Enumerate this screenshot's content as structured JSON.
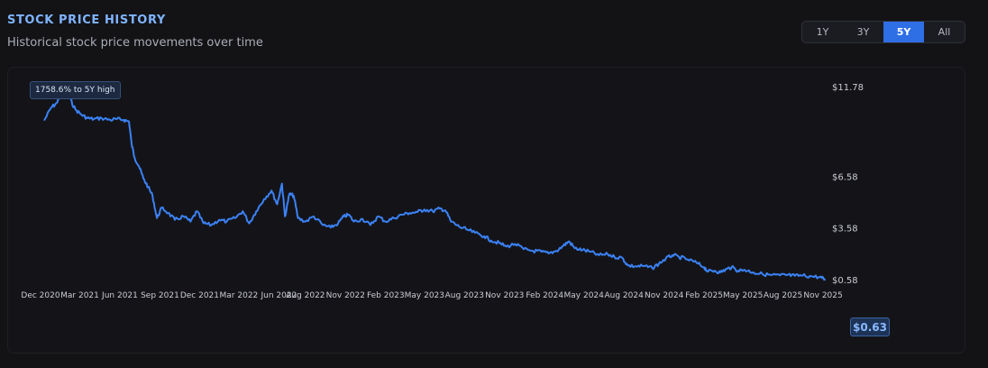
{
  "header": {
    "title": "STOCK PRICE HISTORY",
    "subtitle": "Historical stock price movements over time"
  },
  "range_selector": {
    "options": [
      "1Y",
      "3Y",
      "5Y",
      "All"
    ],
    "selected": "5Y"
  },
  "colors": {
    "accent": "#2f6fe6",
    "line": "#3b82f6",
    "title": "#7fb4ff"
  },
  "annotation": "1758.6% to 5Y high",
  "current_price": "$0.63",
  "chart_data": {
    "type": "line",
    "y_ticks": [
      {
        "value": 11.78,
        "label": "$11.78"
      },
      {
        "value": 6.58,
        "label": "$6.58"
      },
      {
        "value": 3.58,
        "label": "$3.58"
      },
      {
        "value": 0.58,
        "label": "$0.58"
      }
    ],
    "x_ticks": [
      {
        "date": "2020-12-01",
        "label": "Dec 2020"
      },
      {
        "date": "2021-03-01",
        "label": "Mar 2021"
      },
      {
        "date": "2021-06-01",
        "label": "Jun 2021"
      },
      {
        "date": "2021-09-01",
        "label": "Sep 2021"
      },
      {
        "date": "2021-12-01",
        "label": "Dec 2021"
      },
      {
        "date": "2022-03-01",
        "label": "Mar 2022"
      },
      {
        "date": "2022-06-01",
        "label": "Jun 2022"
      },
      {
        "date": "2022-08-01",
        "label": "Aug 2022"
      },
      {
        "date": "2022-11-01",
        "label": "Nov 2022"
      },
      {
        "date": "2023-02-01",
        "label": "Feb 2023"
      },
      {
        "date": "2023-05-01",
        "label": "May 2023"
      },
      {
        "date": "2023-08-01",
        "label": "Aug 2023"
      },
      {
        "date": "2023-11-01",
        "label": "Nov 2023"
      },
      {
        "date": "2024-02-01",
        "label": "Feb 2024"
      },
      {
        "date": "2024-05-01",
        "label": "May 2024"
      },
      {
        "date": "2024-08-01",
        "label": "Aug 2024"
      },
      {
        "date": "2024-11-01",
        "label": "Nov 2024"
      },
      {
        "date": "2025-02-01",
        "label": "Feb 2025"
      },
      {
        "date": "2025-05-01",
        "label": "May 2025"
      },
      {
        "date": "2025-08-01",
        "label": "Aug 2025"
      },
      {
        "date": "2025-11-01",
        "label": "Nov 2025"
      }
    ],
    "grid": false,
    "series": [
      {
        "points": [
          [
            "2020-12-10",
            9.9
          ],
          [
            "2020-12-25",
            10.6
          ],
          [
            "2021-01-08",
            10.9
          ],
          [
            "2021-01-22",
            11.78
          ],
          [
            "2021-02-05",
            11.2
          ],
          [
            "2021-02-19",
            10.5
          ],
          [
            "2021-03-05",
            10.2
          ],
          [
            "2021-03-19",
            10.0
          ],
          [
            "2021-04-02",
            9.95
          ],
          [
            "2021-04-20",
            10.0
          ],
          [
            "2021-05-10",
            9.9
          ],
          [
            "2021-05-25",
            9.95
          ],
          [
            "2021-06-10",
            9.9
          ],
          [
            "2021-06-22",
            9.8
          ],
          [
            "2021-06-28",
            8.5
          ],
          [
            "2021-07-05",
            7.7
          ],
          [
            "2021-07-15",
            7.2
          ],
          [
            "2021-07-25",
            6.5
          ],
          [
            "2021-08-05",
            6.0
          ],
          [
            "2021-08-15",
            5.5
          ],
          [
            "2021-08-25",
            4.2
          ],
          [
            "2021-09-05",
            4.8
          ],
          [
            "2021-09-20",
            4.5
          ],
          [
            "2021-10-05",
            4.1
          ],
          [
            "2021-10-25",
            4.3
          ],
          [
            "2021-11-10",
            4.0
          ],
          [
            "2021-11-25",
            4.6
          ],
          [
            "2021-12-10",
            3.9
          ],
          [
            "2021-12-28",
            3.8
          ],
          [
            "2022-01-15",
            4.1
          ],
          [
            "2022-02-01",
            4.0
          ],
          [
            "2022-02-20",
            4.2
          ],
          [
            "2022-03-10",
            4.6
          ],
          [
            "2022-03-25",
            3.9
          ],
          [
            "2022-04-10",
            4.6
          ],
          [
            "2022-04-28",
            5.3
          ],
          [
            "2022-05-15",
            5.8
          ],
          [
            "2022-05-28",
            5.0
          ],
          [
            "2022-06-08",
            6.2
          ],
          [
            "2022-06-15",
            4.3
          ],
          [
            "2022-06-25",
            5.6
          ],
          [
            "2022-07-05",
            5.5
          ],
          [
            "2022-07-15",
            4.2
          ],
          [
            "2022-08-01",
            4.0
          ],
          [
            "2022-08-20",
            4.3
          ],
          [
            "2022-09-10",
            3.8
          ],
          [
            "2022-09-28",
            3.65
          ],
          [
            "2022-10-15",
            3.9
          ],
          [
            "2022-10-28",
            4.3
          ],
          [
            "2022-11-08",
            4.4
          ],
          [
            "2022-11-20",
            4.0
          ],
          [
            "2022-12-10",
            4.15
          ],
          [
            "2022-12-28",
            3.8
          ],
          [
            "2023-01-15",
            4.3
          ],
          [
            "2023-02-01",
            4.0
          ],
          [
            "2023-02-20",
            4.2
          ],
          [
            "2023-03-10",
            4.4
          ],
          [
            "2023-03-28",
            4.5
          ],
          [
            "2023-04-15",
            4.55
          ],
          [
            "2023-05-01",
            4.7
          ],
          [
            "2023-05-20",
            4.6
          ],
          [
            "2023-06-05",
            4.75
          ],
          [
            "2023-06-18",
            4.65
          ],
          [
            "2023-07-01",
            4.0
          ],
          [
            "2023-07-20",
            3.7
          ],
          [
            "2023-08-05",
            3.55
          ],
          [
            "2023-08-25",
            3.35
          ],
          [
            "2023-09-15",
            3.15
          ],
          [
            "2023-10-01",
            2.9
          ],
          [
            "2023-10-20",
            2.75
          ],
          [
            "2023-11-05",
            2.55
          ],
          [
            "2023-11-25",
            2.7
          ],
          [
            "2023-12-15",
            2.4
          ],
          [
            "2024-01-05",
            2.3
          ],
          [
            "2024-01-25",
            2.25
          ],
          [
            "2024-02-10",
            2.15
          ],
          [
            "2024-02-28",
            2.3
          ],
          [
            "2024-03-15",
            2.6
          ],
          [
            "2024-03-28",
            2.85
          ],
          [
            "2024-04-10",
            2.45
          ],
          [
            "2024-04-28",
            2.35
          ],
          [
            "2024-05-15",
            2.25
          ],
          [
            "2024-06-05",
            2.05
          ],
          [
            "2024-06-25",
            2.1
          ],
          [
            "2024-07-10",
            1.95
          ],
          [
            "2024-07-28",
            1.9
          ],
          [
            "2024-08-10",
            1.45
          ],
          [
            "2024-08-28",
            1.4
          ],
          [
            "2024-09-15",
            1.42
          ],
          [
            "2024-10-05",
            1.3
          ],
          [
            "2024-10-20",
            1.55
          ],
          [
            "2024-11-05",
            1.85
          ],
          [
            "2024-11-20",
            2.05
          ],
          [
            "2024-12-05",
            1.95
          ],
          [
            "2024-12-25",
            1.8
          ],
          [
            "2025-01-15",
            1.6
          ],
          [
            "2025-02-01",
            1.35
          ],
          [
            "2025-02-10",
            1.1
          ],
          [
            "2025-02-25",
            1.15
          ],
          [
            "2025-03-10",
            1.05
          ],
          [
            "2025-03-25",
            1.25
          ],
          [
            "2025-04-05",
            1.35
          ],
          [
            "2025-04-20",
            1.15
          ],
          [
            "2025-05-05",
            1.2
          ],
          [
            "2025-05-25",
            1.05
          ],
          [
            "2025-06-15",
            0.95
          ],
          [
            "2025-07-05",
            0.9
          ],
          [
            "2025-07-25",
            0.88
          ],
          [
            "2025-08-10",
            0.9
          ],
          [
            "2025-08-28",
            0.85
          ],
          [
            "2025-09-15",
            0.87
          ],
          [
            "2025-10-05",
            0.82
          ],
          [
            "2025-10-25",
            0.78
          ],
          [
            "2025-11-05",
            0.63
          ]
        ]
      }
    ]
  }
}
